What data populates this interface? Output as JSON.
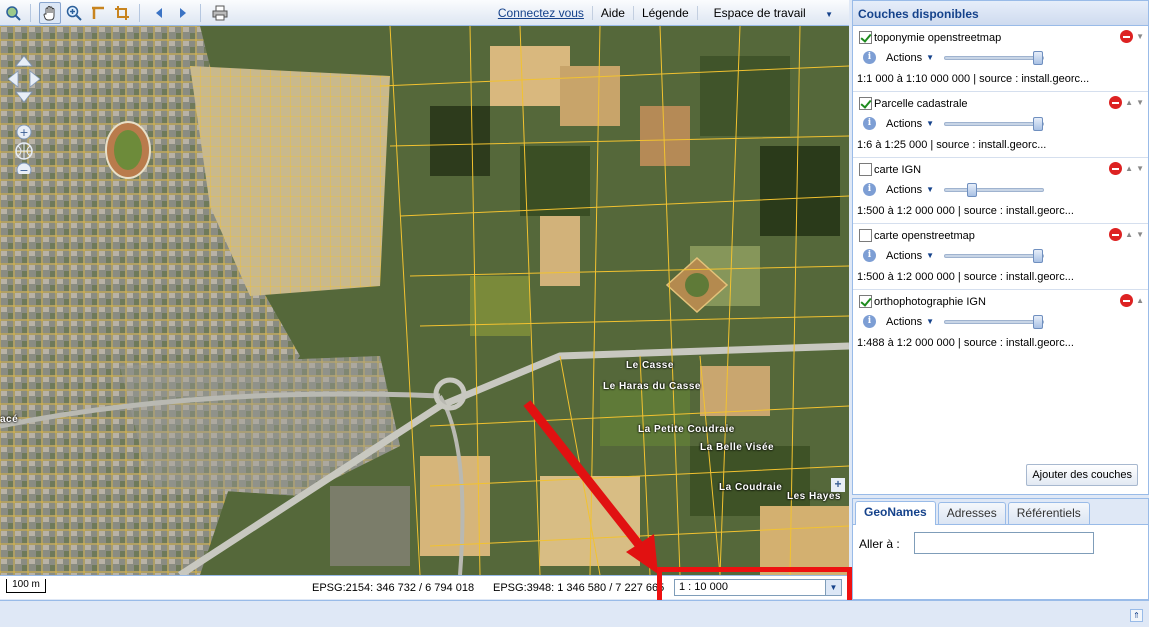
{
  "toolbar": {
    "links": {
      "login": "Connectez vous",
      "help": "Aide",
      "legend": "Légende",
      "workspace": "Espace de travail"
    }
  },
  "map": {
    "labels": [
      "Le Casse",
      "Le Haras du Casse",
      "La Petite Coudraie",
      "La Belle Visée",
      "La Coudraie",
      "Les Hayes",
      "acé"
    ]
  },
  "status": {
    "scalebar": "100 m",
    "epsg2154": "EPSG:2154: 346 732 / 6 794 018",
    "epsg3948": "EPSG:3948: 1 346 580 / 7 227 665",
    "scale_value": "1 : 10 000"
  },
  "layers_panel": {
    "title": "Couches disponibles",
    "actions_label": "Actions",
    "add_button": "Ajouter des couches",
    "layers": [
      {
        "name": "toponymie openstreetmap",
        "checked": true,
        "info": "1:1 000 à 1:10 000 000 | source : install.georc...",
        "opacity": 1.0
      },
      {
        "name": "Parcelle cadastrale",
        "checked": true,
        "info": "1:6 à 1:25 000 | source : install.georc...",
        "opacity": 1.0
      },
      {
        "name": "carte IGN",
        "checked": false,
        "info": "1:500 à 1:2 000 000 | source : install.georc...",
        "opacity": 0.28
      },
      {
        "name": "carte openstreetmap",
        "checked": false,
        "info": "1:500 à 1:2 000 000 | source : install.georc...",
        "opacity": 1.0
      },
      {
        "name": "orthophotographie IGN",
        "checked": true,
        "info": "1:488 à 1:2 000 000 | source : install.georc...",
        "opacity": 1.0
      }
    ]
  },
  "search_panel": {
    "tabs": [
      "GeoNames",
      "Adresses",
      "Référentiels"
    ],
    "goto_label": "Aller à :"
  },
  "colors": {
    "accent": "#15428b",
    "annotation": "#e11111",
    "parcel_lines": "#f2c230"
  }
}
